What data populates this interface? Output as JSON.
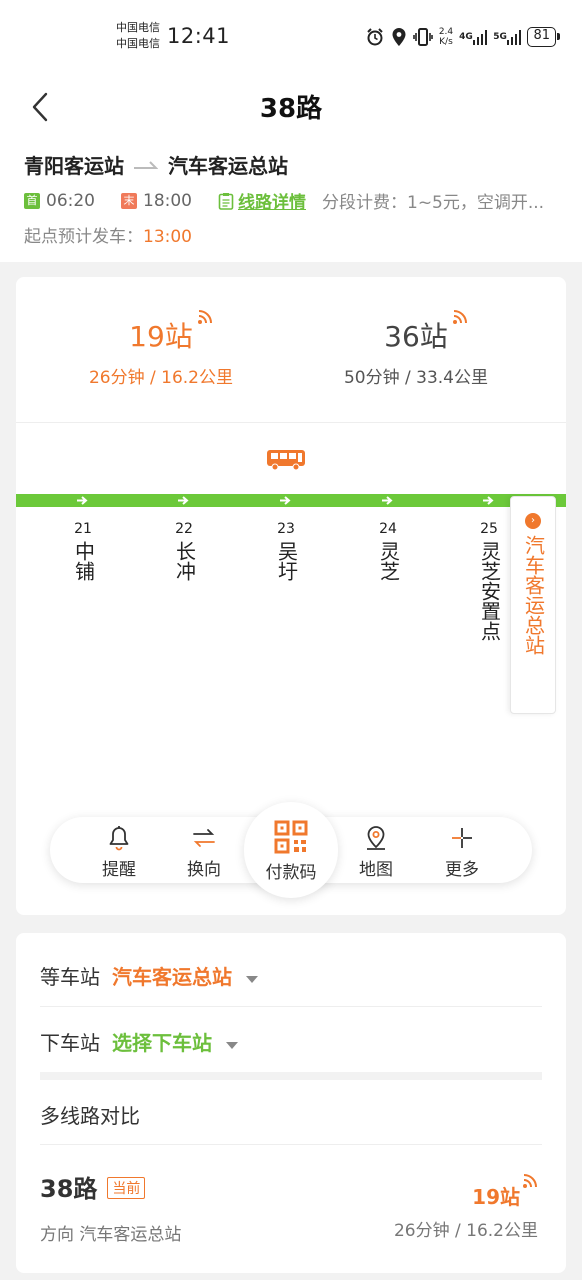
{
  "status": {
    "carrier1": "中国电信",
    "carrier2": "中国电信",
    "time": "12:41",
    "speed_value": "2.4",
    "speed_unit": "K/s",
    "net1": "4G",
    "net2": "5G",
    "battery": "81"
  },
  "header": {
    "title": "38路",
    "from": "青阳客运站",
    "to": "汽车客运总站",
    "first_tag": "首",
    "first_time": "06:20",
    "last_tag": "末",
    "last_time": "18:00",
    "detail_link": "线路详情",
    "fare_info": "分段计费：1~5元，空调开...",
    "depart_label": "起点预计发车：",
    "depart_time": "13:00"
  },
  "eta": {
    "near_stops": "19站",
    "near_detail": "26分钟 / 16.2公里",
    "far_stops": "36站",
    "far_detail": "50分钟 / 33.4公里"
  },
  "stops": [
    {
      "num": "21",
      "name": "中铺"
    },
    {
      "num": "22",
      "name": "长冲"
    },
    {
      "num": "23",
      "name": "吴圩"
    },
    {
      "num": "24",
      "name": "灵芝"
    },
    {
      "num": "25",
      "name": "灵芝安置点"
    }
  ],
  "terminal": {
    "name": "汽车客运总站"
  },
  "actions": {
    "remind": "提醒",
    "reverse": "换向",
    "pay": "付款码",
    "map": "地图",
    "more": "更多"
  },
  "boarding": {
    "wait_label": "等车站",
    "wait_value": "汽车客运总站",
    "alight_label": "下车站",
    "alight_value": "选择下车站"
  },
  "compare": {
    "title": "多线路对比",
    "route": "38路",
    "badge": "当前",
    "direction": "方向 汽车客运总站",
    "stops": "19站",
    "detail": "26分钟 / 16.2公里"
  },
  "colors": {
    "accent_orange": "#f0782d",
    "accent_green": "#6cbf3c",
    "route_bar": "#6cc93a"
  }
}
